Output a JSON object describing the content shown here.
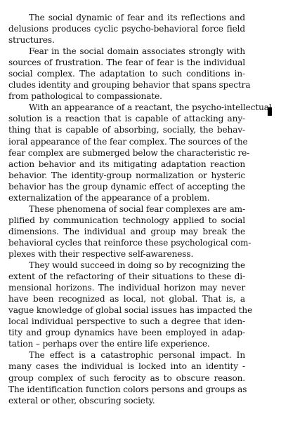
{
  "document": {
    "paragraphs": [
      {
        "lines": [
          "The social dynamic of fear and its reflections and",
          "delusions produces cyclic psycho-behavioral force field",
          "structures."
        ]
      },
      {
        "lines": [
          "Fear in the social domain associates strongly with",
          "sources of frustration. The fear of fear is the individual",
          "social complex. The adaptation to such conditions in-",
          "cludes identity and grouping behavior that spans spectra",
          "from pathological to compassionate."
        ]
      },
      {
        "lines": [
          "With an appearance of a reactant, the psycho-intellectual",
          "solution is a reaction that is capable of attacking any-",
          "thing that is capable of absorbing, socially, the behav-",
          "ioral appearance of the fear complex. The sources of the",
          "fear complex are submerged below the characteristic re-",
          "action behavior and its mitigating adaptation reaction",
          "behavior. The identity-group normalization or hysteric",
          "behavior has the group dynamic effect of accepting the",
          "externalization of the appearance of a problem."
        ]
      },
      {
        "lines": [
          "These phenomena of social fear complexes are am-",
          "plified by communication technology applied to social",
          "dimensions. The individual and group may break the",
          "behavioral cycles that reinforce these psychological com-",
          "plexes with their respective self-awareness."
        ]
      },
      {
        "lines": [
          "They would succeed in doing so by recognizing the",
          "extent of the refactoring of their situations to these di-",
          "mensional horizons. The individual horizon may never",
          "have been recognized as local, not global. That is, a",
          "vague knowledge of global social issues has impacted the",
          "local individual perspective to such a degree that iden-",
          "tity and group dynamics have been employed in adap-",
          "tation – perhaps over the entire life experience."
        ]
      },
      {
        "lines": [
          "The effect is a catastrophic personal impact. In",
          "many cases the individual is locked into an identity -",
          "group complex of such ferocity as to obscure reason.",
          "The identification function colors persons and groups as",
          "exteral or other, obscuring society."
        ]
      }
    ]
  }
}
